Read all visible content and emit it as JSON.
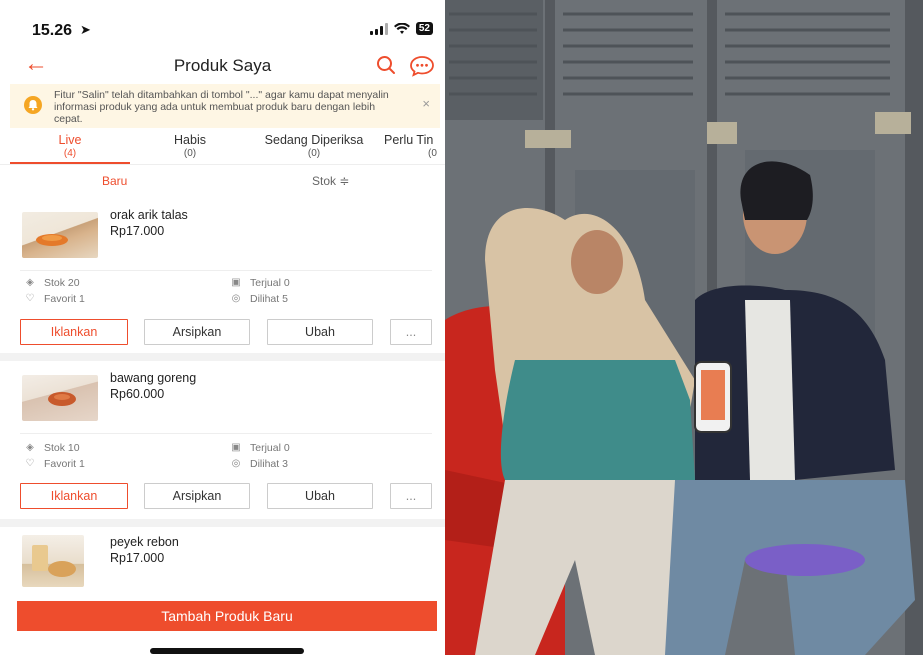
{
  "status": {
    "time": "15.26",
    "battery": "52"
  },
  "nav": {
    "title": "Produk Saya"
  },
  "notice": {
    "text": "Fitur \"Salin\" telah ditambahkan di tombol \"...\" agar kamu dapat menyalin informasi produk yang ada untuk membuat produk baru dengan lebih cepat.",
    "close": "×"
  },
  "tabs": [
    {
      "label": "Live",
      "count": "(4)"
    },
    {
      "label": "Habis",
      "count": "(0)"
    },
    {
      "label": "Sedang Diperiksa",
      "count": "(0)"
    },
    {
      "label": "Perlu Tin",
      "count": "(0"
    }
  ],
  "sort": {
    "baru": "Baru",
    "stok": "Stok ≑"
  },
  "products": [
    {
      "name": "orak arik talas",
      "price": "Rp17.000",
      "stok": "Stok 20",
      "terjual": "Terjual 0",
      "favorit": "Favorit 1",
      "dilihat": "Dilihat 5"
    },
    {
      "name": "bawang goreng",
      "price": "Rp60.000",
      "stok": "Stok 10",
      "terjual": "Terjual 0",
      "favorit": "Favorit 1",
      "dilihat": "Dilihat 3"
    },
    {
      "name": "peyek rebon",
      "price": "Rp17.000"
    }
  ],
  "actions": {
    "iklankan": "Iklankan",
    "arsipkan": "Arsipkan",
    "ubah": "Ubah",
    "more": "..."
  },
  "add_button": "Tambah Produk Baru",
  "colors": {
    "accent": "#ee4d2d",
    "notice_bg": "#fef6e4"
  }
}
